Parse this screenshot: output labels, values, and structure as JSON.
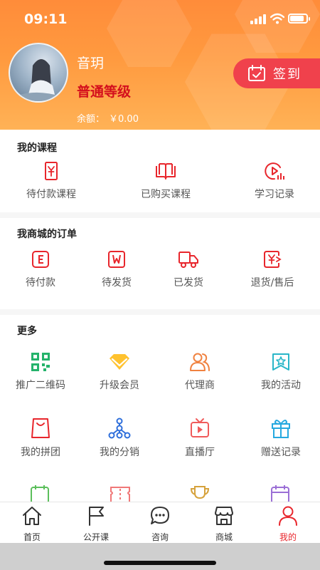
{
  "status": {
    "time": "09:11"
  },
  "profile": {
    "name": "音玥",
    "level": "普通等级",
    "balance_label": "余额：",
    "balance_value": "￥0.00"
  },
  "signin": {
    "label": "签到"
  },
  "courses": {
    "title": "我的课程",
    "items": [
      {
        "label": "待付款课程",
        "icon": "yen-receipt-icon"
      },
      {
        "label": "已购买课程",
        "icon": "open-book-icon"
      },
      {
        "label": "学习记录",
        "icon": "play-record-icon"
      }
    ]
  },
  "orders": {
    "title": "我商城的订单",
    "items": [
      {
        "label": "待付款",
        "icon": "wallet-icon"
      },
      {
        "label": "待发货",
        "icon": "package-icon"
      },
      {
        "label": "已发货",
        "icon": "truck-icon"
      },
      {
        "label": "退货/售后",
        "icon": "refund-icon"
      }
    ]
  },
  "more": {
    "title": "更多",
    "items": [
      {
        "label": "推广二维码",
        "icon": "qr-code-icon"
      },
      {
        "label": "升级会员",
        "icon": "diamond-icon"
      },
      {
        "label": "代理商",
        "icon": "people-icon"
      },
      {
        "label": "我的活动",
        "icon": "star-bookmark-icon"
      },
      {
        "label": "我的拼团",
        "icon": "shopping-bag-icon"
      },
      {
        "label": "我的分销",
        "icon": "network-icon"
      },
      {
        "label": "直播厅",
        "icon": "tv-play-icon"
      },
      {
        "label": "赠送记录",
        "icon": "gift-icon"
      }
    ]
  },
  "tabs": [
    {
      "label": "首页",
      "icon": "house-icon"
    },
    {
      "label": "公开课",
      "icon": "flag-icon"
    },
    {
      "label": "咨询",
      "icon": "chat-icon"
    },
    {
      "label": "商城",
      "icon": "shop-icon"
    },
    {
      "label": "我的",
      "icon": "person-icon",
      "active": true
    }
  ],
  "colors": {
    "accent": "#e8262c",
    "header_orange": "#ff9a3f",
    "signin_red": "#f0414c",
    "level_red": "#d4101d"
  }
}
